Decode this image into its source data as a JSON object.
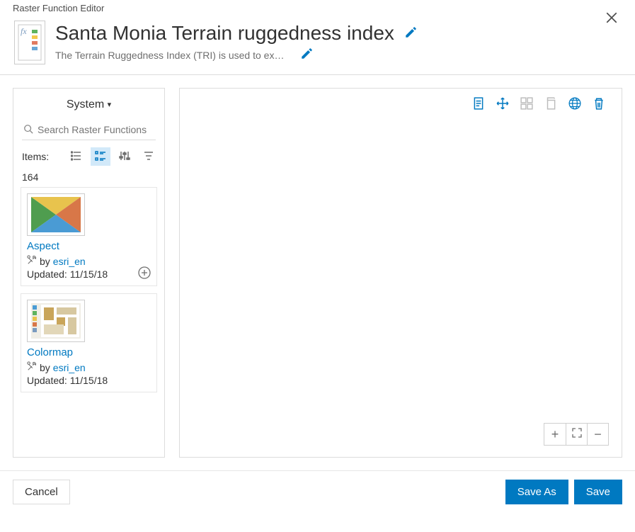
{
  "header": {
    "windowTitle": "Raster Function Editor",
    "title": "Santa Monia Terrain ruggedness index",
    "description": "The Terrain Ruggedness Index (TRI) is used to expres…"
  },
  "sidebar": {
    "categoryLabel": "System",
    "searchPlaceholder": "Search Raster Functions",
    "itemsLabel": "Items:",
    "count": "164",
    "functions": [
      {
        "name": "Aspect",
        "byWord": "by",
        "author": "esri_en",
        "updated": "Updated: 11/15/18"
      },
      {
        "name": "Colormap",
        "byWord": "by",
        "author": "esri_en",
        "updated": "Updated: 11/15/18"
      }
    ]
  },
  "footer": {
    "cancel": "Cancel",
    "saveAs": "Save As",
    "save": "Save"
  }
}
